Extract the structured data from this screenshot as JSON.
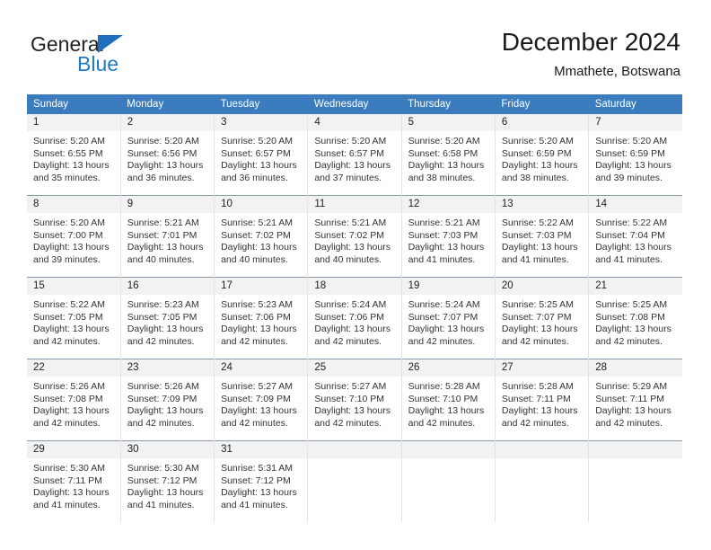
{
  "brand": {
    "name_top": "General",
    "name_bottom": "Blue",
    "triangle_color": "#1f6fbd",
    "blue_color": "#1f7ac4"
  },
  "header": {
    "title": "December 2024",
    "subtitle": "Mmathete, Botswana"
  },
  "theme": {
    "header_blue": "#3b7cbf",
    "daynum_bg": "#f2f2f2",
    "row_divider": "#8a9aab",
    "col_divider": "#e3e3e3"
  },
  "weekday_headers": [
    "Sunday",
    "Monday",
    "Tuesday",
    "Wednesday",
    "Thursday",
    "Friday",
    "Saturday"
  ],
  "weeks": [
    [
      {
        "day": "1",
        "sunrise": "Sunrise: 5:20 AM",
        "sunset": "Sunset: 6:55 PM",
        "daylight": "Daylight: 13 hours and 35 minutes."
      },
      {
        "day": "2",
        "sunrise": "Sunrise: 5:20 AM",
        "sunset": "Sunset: 6:56 PM",
        "daylight": "Daylight: 13 hours and 36 minutes."
      },
      {
        "day": "3",
        "sunrise": "Sunrise: 5:20 AM",
        "sunset": "Sunset: 6:57 PM",
        "daylight": "Daylight: 13 hours and 36 minutes."
      },
      {
        "day": "4",
        "sunrise": "Sunrise: 5:20 AM",
        "sunset": "Sunset: 6:57 PM",
        "daylight": "Daylight: 13 hours and 37 minutes."
      },
      {
        "day": "5",
        "sunrise": "Sunrise: 5:20 AM",
        "sunset": "Sunset: 6:58 PM",
        "daylight": "Daylight: 13 hours and 38 minutes."
      },
      {
        "day": "6",
        "sunrise": "Sunrise: 5:20 AM",
        "sunset": "Sunset: 6:59 PM",
        "daylight": "Daylight: 13 hours and 38 minutes."
      },
      {
        "day": "7",
        "sunrise": "Sunrise: 5:20 AM",
        "sunset": "Sunset: 6:59 PM",
        "daylight": "Daylight: 13 hours and 39 minutes."
      }
    ],
    [
      {
        "day": "8",
        "sunrise": "Sunrise: 5:20 AM",
        "sunset": "Sunset: 7:00 PM",
        "daylight": "Daylight: 13 hours and 39 minutes."
      },
      {
        "day": "9",
        "sunrise": "Sunrise: 5:21 AM",
        "sunset": "Sunset: 7:01 PM",
        "daylight": "Daylight: 13 hours and 40 minutes."
      },
      {
        "day": "10",
        "sunrise": "Sunrise: 5:21 AM",
        "sunset": "Sunset: 7:02 PM",
        "daylight": "Daylight: 13 hours and 40 minutes."
      },
      {
        "day": "11",
        "sunrise": "Sunrise: 5:21 AM",
        "sunset": "Sunset: 7:02 PM",
        "daylight": "Daylight: 13 hours and 40 minutes."
      },
      {
        "day": "12",
        "sunrise": "Sunrise: 5:21 AM",
        "sunset": "Sunset: 7:03 PM",
        "daylight": "Daylight: 13 hours and 41 minutes."
      },
      {
        "day": "13",
        "sunrise": "Sunrise: 5:22 AM",
        "sunset": "Sunset: 7:03 PM",
        "daylight": "Daylight: 13 hours and 41 minutes."
      },
      {
        "day": "14",
        "sunrise": "Sunrise: 5:22 AM",
        "sunset": "Sunset: 7:04 PM",
        "daylight": "Daylight: 13 hours and 41 minutes."
      }
    ],
    [
      {
        "day": "15",
        "sunrise": "Sunrise: 5:22 AM",
        "sunset": "Sunset: 7:05 PM",
        "daylight": "Daylight: 13 hours and 42 minutes."
      },
      {
        "day": "16",
        "sunrise": "Sunrise: 5:23 AM",
        "sunset": "Sunset: 7:05 PM",
        "daylight": "Daylight: 13 hours and 42 minutes."
      },
      {
        "day": "17",
        "sunrise": "Sunrise: 5:23 AM",
        "sunset": "Sunset: 7:06 PM",
        "daylight": "Daylight: 13 hours and 42 minutes."
      },
      {
        "day": "18",
        "sunrise": "Sunrise: 5:24 AM",
        "sunset": "Sunset: 7:06 PM",
        "daylight": "Daylight: 13 hours and 42 minutes."
      },
      {
        "day": "19",
        "sunrise": "Sunrise: 5:24 AM",
        "sunset": "Sunset: 7:07 PM",
        "daylight": "Daylight: 13 hours and 42 minutes."
      },
      {
        "day": "20",
        "sunrise": "Sunrise: 5:25 AM",
        "sunset": "Sunset: 7:07 PM",
        "daylight": "Daylight: 13 hours and 42 minutes."
      },
      {
        "day": "21",
        "sunrise": "Sunrise: 5:25 AM",
        "sunset": "Sunset: 7:08 PM",
        "daylight": "Daylight: 13 hours and 42 minutes."
      }
    ],
    [
      {
        "day": "22",
        "sunrise": "Sunrise: 5:26 AM",
        "sunset": "Sunset: 7:08 PM",
        "daylight": "Daylight: 13 hours and 42 minutes."
      },
      {
        "day": "23",
        "sunrise": "Sunrise: 5:26 AM",
        "sunset": "Sunset: 7:09 PM",
        "daylight": "Daylight: 13 hours and 42 minutes."
      },
      {
        "day": "24",
        "sunrise": "Sunrise: 5:27 AM",
        "sunset": "Sunset: 7:09 PM",
        "daylight": "Daylight: 13 hours and 42 minutes."
      },
      {
        "day": "25",
        "sunrise": "Sunrise: 5:27 AM",
        "sunset": "Sunset: 7:10 PM",
        "daylight": "Daylight: 13 hours and 42 minutes."
      },
      {
        "day": "26",
        "sunrise": "Sunrise: 5:28 AM",
        "sunset": "Sunset: 7:10 PM",
        "daylight": "Daylight: 13 hours and 42 minutes."
      },
      {
        "day": "27",
        "sunrise": "Sunrise: 5:28 AM",
        "sunset": "Sunset: 7:11 PM",
        "daylight": "Daylight: 13 hours and 42 minutes."
      },
      {
        "day": "28",
        "sunrise": "Sunrise: 5:29 AM",
        "sunset": "Sunset: 7:11 PM",
        "daylight": "Daylight: 13 hours and 42 minutes."
      }
    ],
    [
      {
        "day": "29",
        "sunrise": "Sunrise: 5:30 AM",
        "sunset": "Sunset: 7:11 PM",
        "daylight": "Daylight: 13 hours and 41 minutes."
      },
      {
        "day": "30",
        "sunrise": "Sunrise: 5:30 AM",
        "sunset": "Sunset: 7:12 PM",
        "daylight": "Daylight: 13 hours and 41 minutes."
      },
      {
        "day": "31",
        "sunrise": "Sunrise: 5:31 AM",
        "sunset": "Sunset: 7:12 PM",
        "daylight": "Daylight: 13 hours and 41 minutes."
      },
      {
        "day": "",
        "sunrise": "",
        "sunset": "",
        "daylight": ""
      },
      {
        "day": "",
        "sunrise": "",
        "sunset": "",
        "daylight": ""
      },
      {
        "day": "",
        "sunrise": "",
        "sunset": "",
        "daylight": ""
      },
      {
        "day": "",
        "sunrise": "",
        "sunset": "",
        "daylight": ""
      }
    ]
  ]
}
